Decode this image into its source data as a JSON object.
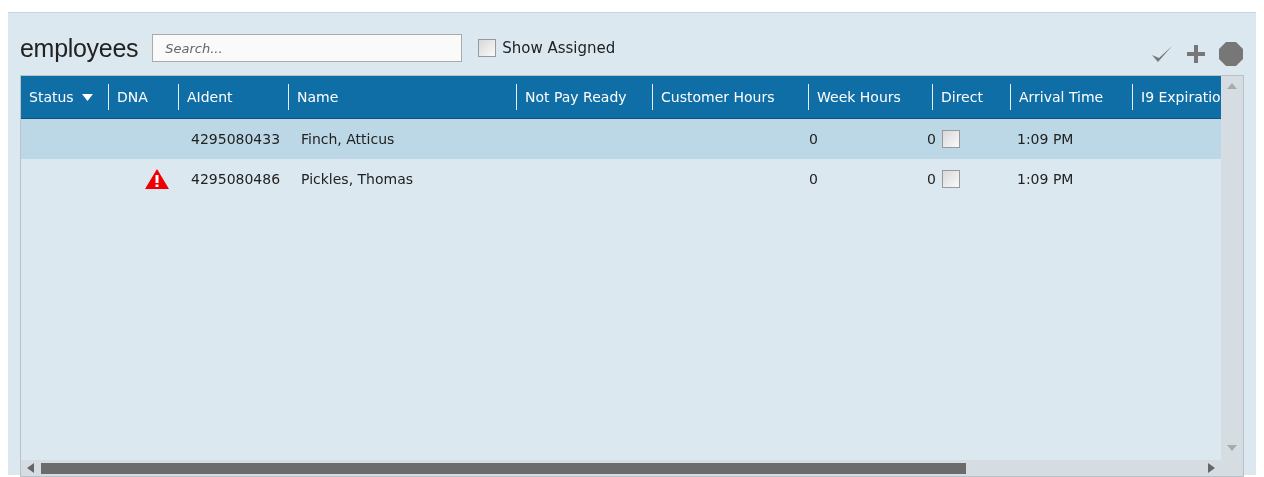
{
  "title": "employees",
  "search": {
    "placeholder": "Search..."
  },
  "show_assigned": {
    "label": "Show Assigned",
    "checked": false
  },
  "table": {
    "columns": [
      {
        "label": "Status",
        "sortable": true
      },
      {
        "label": "DNA",
        "sortable": false
      },
      {
        "label": "AIdent",
        "sortable": false
      },
      {
        "label": "Name",
        "sortable": false
      },
      {
        "label": "Not Pay Ready",
        "sortable": false
      },
      {
        "label": "Customer Hours",
        "sortable": false
      },
      {
        "label": "Week Hours",
        "sortable": false
      },
      {
        "label": "Direct",
        "sortable": false
      },
      {
        "label": "Arrival Time",
        "sortable": false
      },
      {
        "label": "I9 Expiratio",
        "sortable": false
      }
    ],
    "rows": [
      {
        "selected": true,
        "dna_warning": false,
        "aident": "4295080433",
        "name": "Finch, Atticus",
        "week_hours": "0",
        "direct": "0",
        "direct_checked": false,
        "arrival_time": "1:09 PM"
      },
      {
        "selected": false,
        "dna_warning": true,
        "aident": "4295080486",
        "name": "Pickles, Thomas",
        "week_hours": "0",
        "direct": "0",
        "direct_checked": false,
        "arrival_time": "1:09 PM"
      }
    ]
  }
}
